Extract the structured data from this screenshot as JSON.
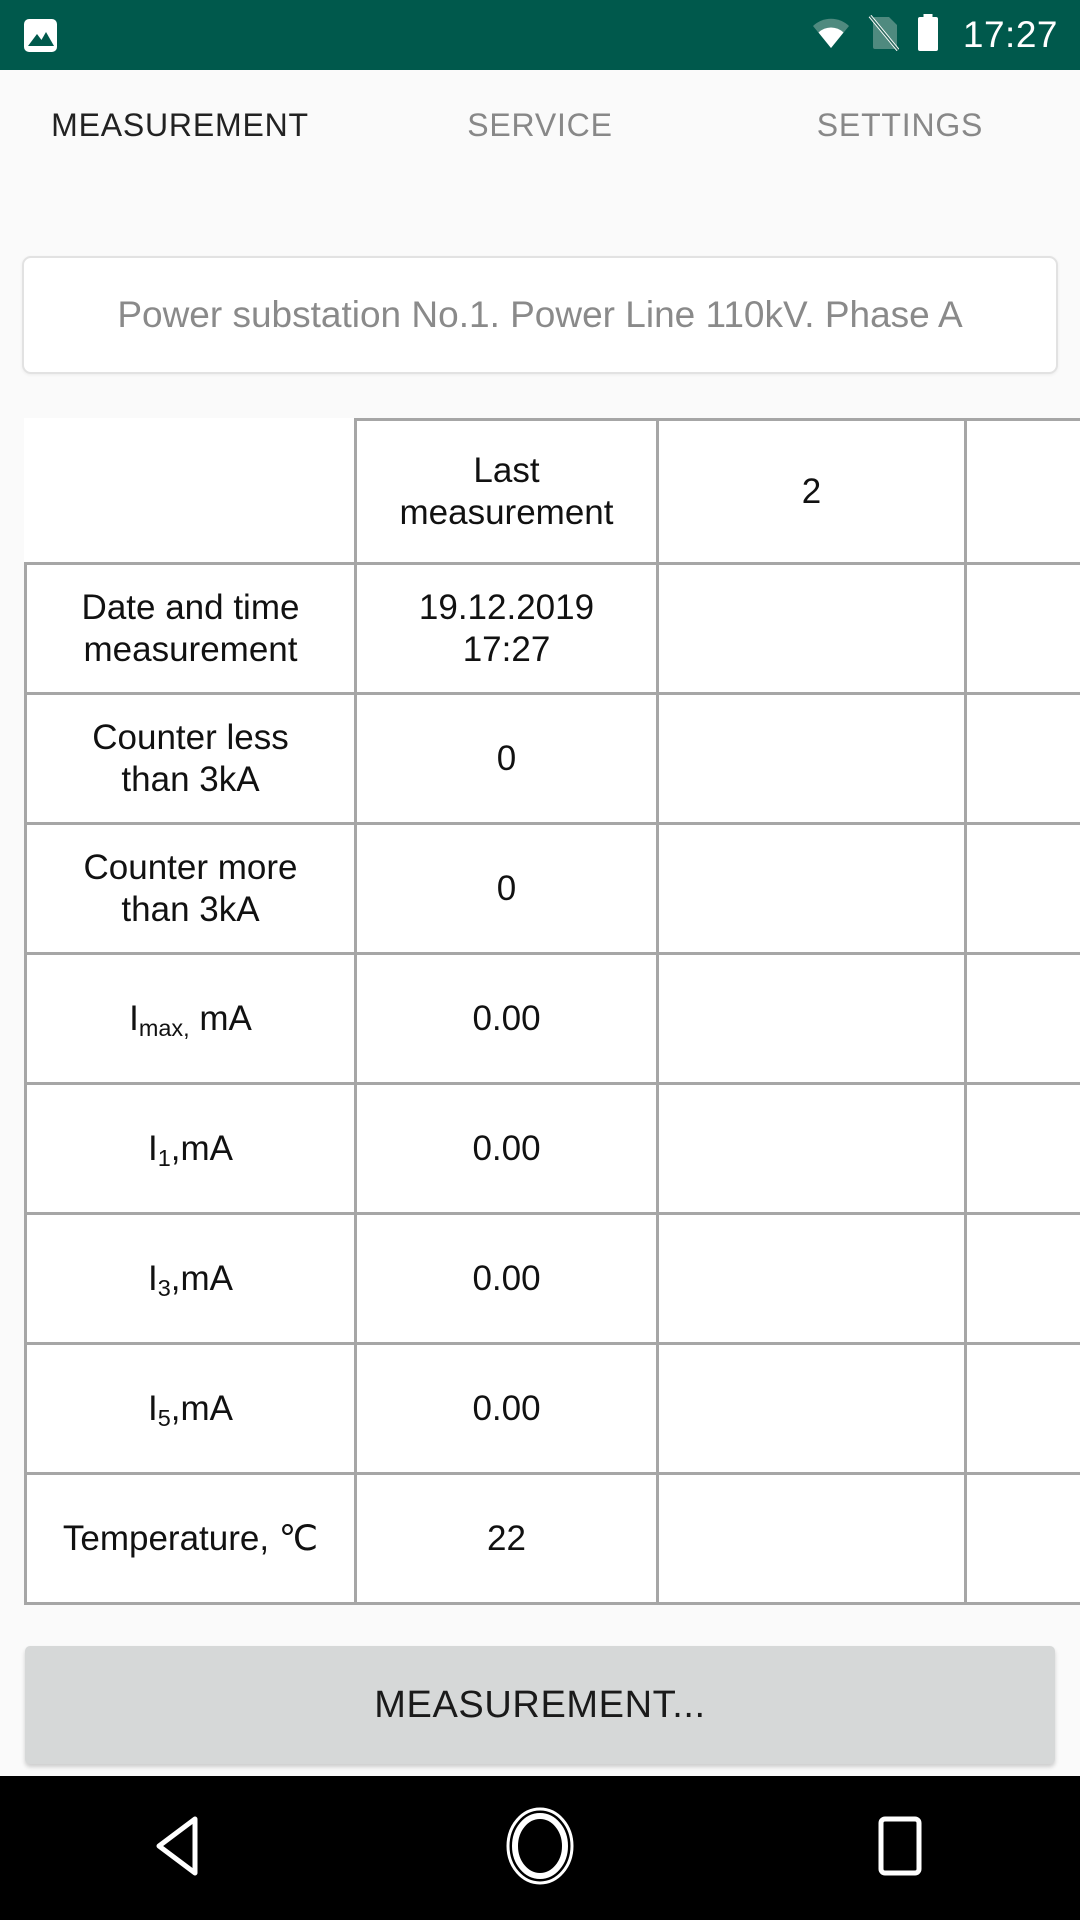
{
  "status_bar": {
    "notification_icon": "image-icon",
    "wifi_icon": "wifi-icon",
    "sim_icon": "no-sim-icon",
    "battery_icon": "battery-icon",
    "clock": "17:27",
    "background_color": "#00594c",
    "foreground_color": "#ffffff"
  },
  "tabs": [
    {
      "label": "MEASUREMENT",
      "active": true
    },
    {
      "label": "SERVICE",
      "active": false
    },
    {
      "label": "SETTINGS",
      "active": false
    }
  ],
  "name_field": {
    "value": "Power substation No.1. Power Line 110kV. Phase A",
    "placeholder": "Power substation No.1. Power Line 110kV. Phase A"
  },
  "table": {
    "header": [
      "",
      "Last measurement",
      "2",
      ""
    ],
    "rows": [
      {
        "label_lines": [
          "Date and time",
          "measurement"
        ],
        "label_html": "Date and time<br>measurement",
        "value_lines": [
          "19.12.2019",
          "17:27"
        ],
        "value_html": "19.12.2019<br>17:27",
        "col3": "",
        "col4": ""
      },
      {
        "label_lines": [
          "Counter less",
          "than 3kA"
        ],
        "label_html": "Counter less<br>than 3kA",
        "value_lines": [
          "0"
        ],
        "value_html": "0",
        "col3": "",
        "col4": ""
      },
      {
        "label_lines": [
          "Counter more",
          "than 3kA"
        ],
        "label_html": "Counter more<br>than 3kA",
        "value_lines": [
          "0"
        ],
        "value_html": "0",
        "col3": "",
        "col4": ""
      },
      {
        "label_lines": [
          "Imax, mA"
        ],
        "label_html": "I<sub>max,</sub> mA",
        "value_lines": [
          "0.00"
        ],
        "value_html": "0.00",
        "col3": "",
        "col4": ""
      },
      {
        "label_lines": [
          "I1, mA"
        ],
        "label_html": "I<sub>1</sub>,mA",
        "value_lines": [
          "0.00"
        ],
        "value_html": "0.00",
        "col3": "",
        "col4": ""
      },
      {
        "label_lines": [
          "I3, mA"
        ],
        "label_html": "I<sub>3</sub>,mA",
        "value_lines": [
          "0.00"
        ],
        "value_html": "0.00",
        "col3": "",
        "col4": ""
      },
      {
        "label_lines": [
          "I5, mA"
        ],
        "label_html": "I<sub>5</sub>,mA",
        "value_lines": [
          "0.00"
        ],
        "value_html": "0.00",
        "col3": "",
        "col4": ""
      },
      {
        "label_lines": [
          "Temperature, ℃"
        ],
        "label_html": "Temperature, ℃",
        "value_lines": [
          "22"
        ],
        "value_html": "22",
        "col3": "",
        "col4": ""
      }
    ]
  },
  "measurement_button": {
    "label": "MEASUREMENT...",
    "background_color": "#d6d8d8"
  },
  "nav_bar": {
    "back_icon": "back-triangle-icon",
    "home_icon": "home-circle-icon",
    "recents_icon": "recents-square-icon",
    "background_color": "#000000"
  },
  "colors": {
    "accent": "#00594c",
    "page_background": "#fafafa",
    "table_border": "#a6a6a6",
    "muted_text": "#8a8a8a"
  }
}
